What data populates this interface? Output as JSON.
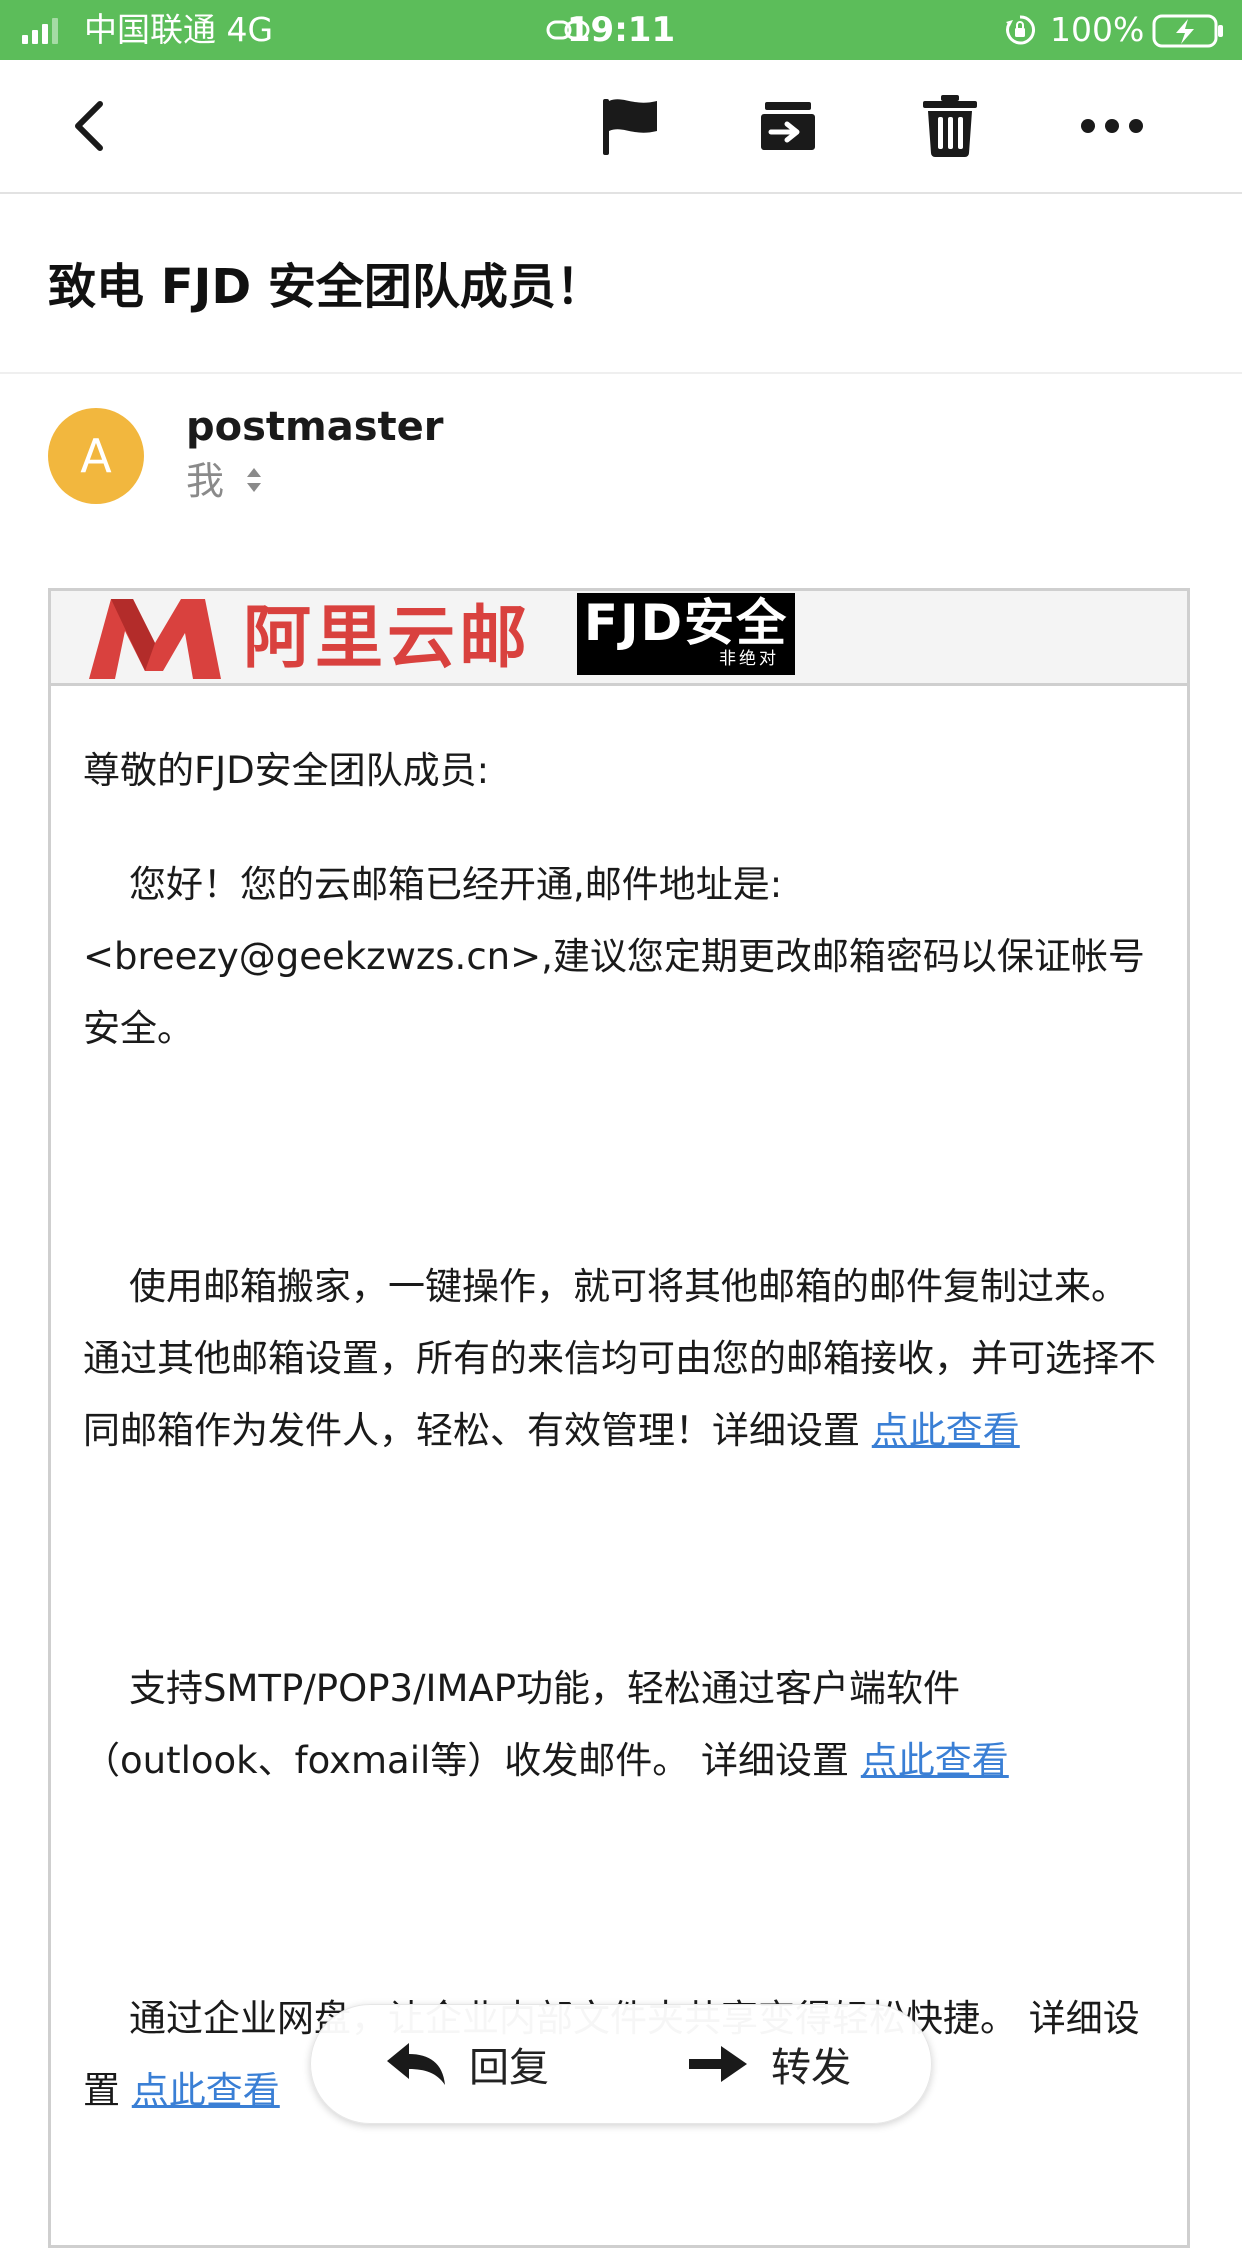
{
  "status_bar": {
    "carrier": "中国联通   4G",
    "time": "19:11",
    "battery": "100%"
  },
  "toolbar": {
    "back_icon": "chevron-left-icon",
    "flag_icon": "flag-icon",
    "move_icon": "move-to-folder-icon",
    "trash_icon": "trash-icon",
    "more_icon": "more-dots-icon"
  },
  "email": {
    "subject": "致电 FJD 安全团队成员！",
    "sender": {
      "avatar_letter": "A",
      "avatar_color": "#f2b73e",
      "name": "postmaster",
      "recipient": "我"
    },
    "banner": {
      "brand_text": "阿里云邮",
      "fjd_main": "FJD安全",
      "fjd_sub": "非绝对"
    },
    "body": {
      "greeting": "尊敬的FJD安全团队成员:",
      "para1": "您好！您的云邮箱已经开通,邮件地址是: <breezy@geekzwzs.cn>,建议您定期更改邮箱密码以保证帐号安全。",
      "para2": "使用邮箱搬家，一键操作，就可将其他邮箱的邮件复制过来。通过其他邮箱设置，所有的来信均可由您的邮箱接收，并可选择不同邮箱作为发件人，轻松、有效管理！详细设置 ",
      "para2_link": "点此查看",
      "para3": "支持SMTP/POP3/IMAP功能，轻松通过客户端软件（outlook、foxmail等）收发邮件。 详细设置 ",
      "para3_link": "点此查看",
      "para4": "通过企业网盘，让企业内部文件夹共享变得轻松快捷。 详细设置 ",
      "para4_link": "点此查看"
    }
  },
  "actions": {
    "reply": "回复",
    "forward": "转发"
  },
  "colors": {
    "status_bar": "#5cbd5a",
    "link": "#3a7fd5",
    "brand_red": "#d9413e"
  }
}
